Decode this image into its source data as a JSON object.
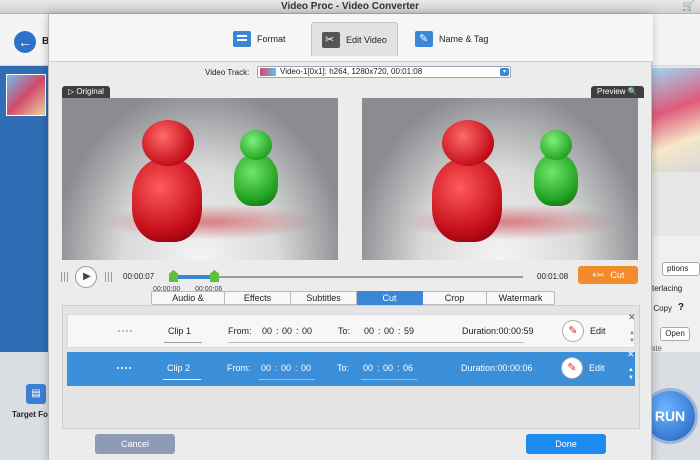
{
  "app": {
    "title": "Video Proc - Video Converter",
    "back_label": "B",
    "target_format_label": "Target Fo",
    "run_label": "RUN",
    "options_label": "ptions",
    "interlacing_label": "terlacing",
    "copy_label": "Copy",
    "help_label": "?",
    "open_label": "Open",
    "side_text": "ate"
  },
  "tabs": [
    {
      "label": "Format",
      "icon": "format-icon"
    },
    {
      "label": "Edit Video",
      "icon": "edit-video-icon",
      "active": true
    },
    {
      "label": "Name & Tag",
      "icon": "name-tag-icon"
    }
  ],
  "video_track": {
    "label": "Video Track:",
    "value": "Video-1[0x1]: h264, 1280x720, 00:01:08"
  },
  "viewer": {
    "original_label": "Original",
    "preview_label": "Preview"
  },
  "timeline": {
    "current_time": "00:00:07",
    "end_time": "00:01:08",
    "marker_start": "00:00:00",
    "marker_end": "00:00:06",
    "cut_label": "Cut"
  },
  "edit_tabs": [
    {
      "label": "Audio & Video"
    },
    {
      "label": "Effects"
    },
    {
      "label": "Subtitles"
    },
    {
      "label": "Cut",
      "active": true
    },
    {
      "label": "Crop"
    },
    {
      "label": "Watermark"
    }
  ],
  "clips": [
    {
      "name": "Clip 1",
      "from_label": "From:",
      "from_h": "00",
      "from_m": "00",
      "from_s": "00",
      "to_label": "To:",
      "to_h": "00",
      "to_m": "00",
      "to_s": "59",
      "duration": "Duration:00:00:59",
      "edit_label": "Edit"
    },
    {
      "name": "Clip 2",
      "from_label": "From:",
      "from_h": "00",
      "from_m": "00",
      "from_s": "00",
      "to_label": "To:",
      "to_h": "00",
      "to_m": "00",
      "to_s": "06",
      "duration": "Duration:00:00:06",
      "edit_label": "Edit",
      "selected": true
    }
  ],
  "footer": {
    "cancel_label": "Cancel",
    "done_label": "Done"
  },
  "colors": {
    "accent": "#3b86d6",
    "cut_button": "#f28b2b",
    "selected_row": "#3b8fd9",
    "done_button": "#1d8cf0",
    "cancel_button": "#8d9bb6"
  }
}
